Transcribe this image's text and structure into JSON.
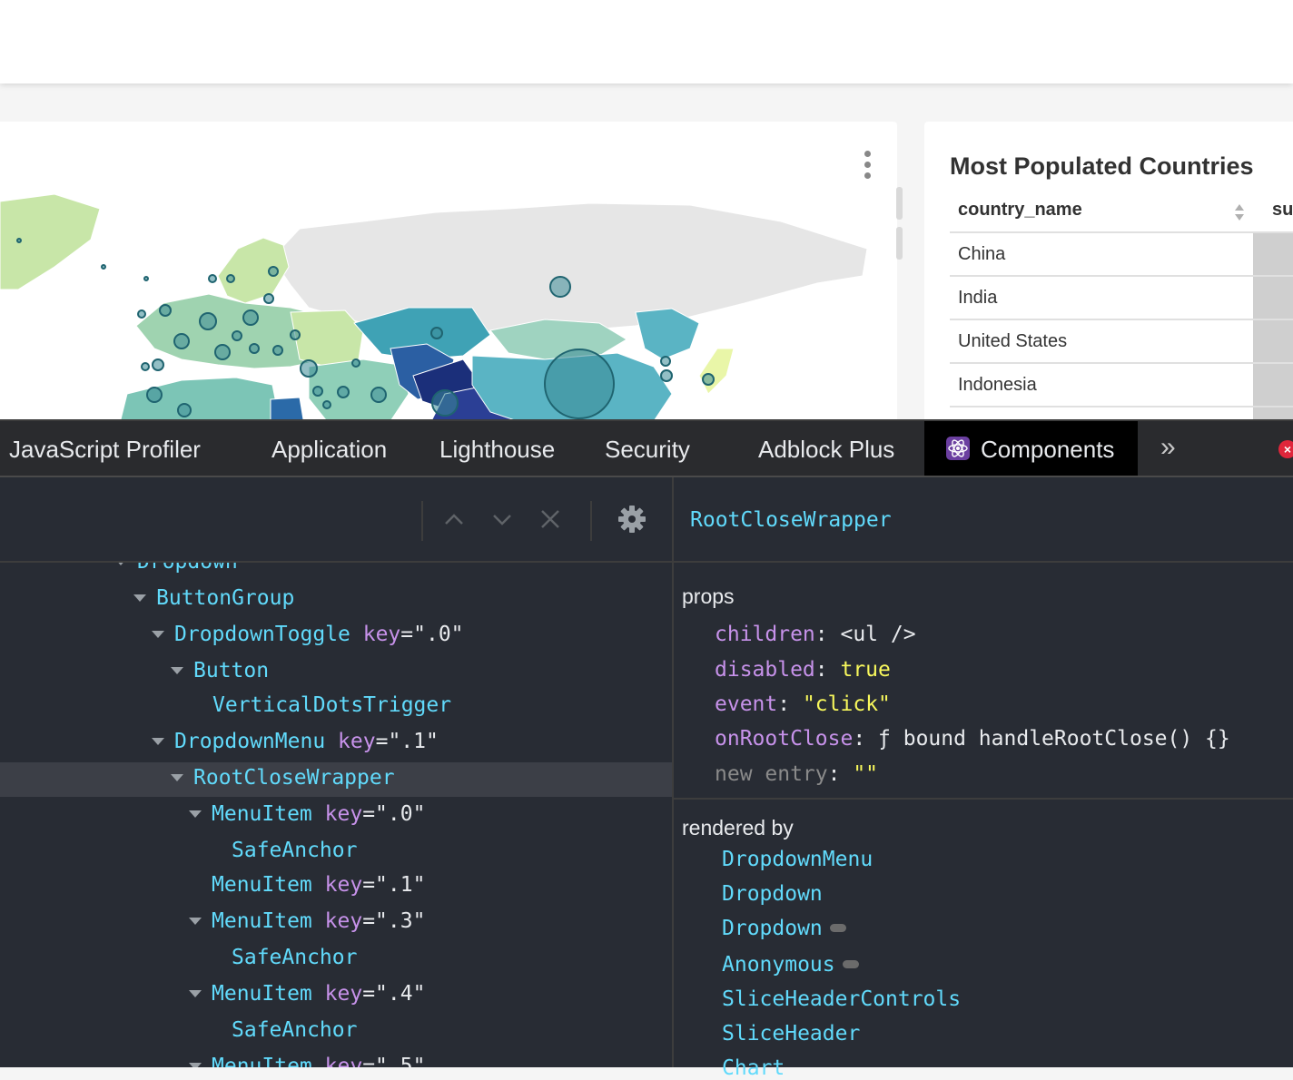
{
  "table_card": {
    "title": "Most Populated Countries",
    "columns": [
      "country_name",
      "su"
    ],
    "rows": [
      "China",
      "India",
      "United States",
      "Indonesia"
    ]
  },
  "devtools": {
    "tabs": [
      "JavaScript Profiler",
      "Application",
      "Lighthouse",
      "Security",
      "Adblock Plus",
      "Components"
    ],
    "active_tab": "Components",
    "tabs_overflow_icon": "chevron-double-right-icon",
    "toolbar_icons": [
      "chevron-up-icon",
      "chevron-down-icon",
      "close-icon",
      "gear-icon"
    ],
    "tree": [
      {
        "name": "Dropdown",
        "expanded": true
      },
      {
        "name": "ButtonGroup",
        "expanded": true
      },
      {
        "name": "DropdownToggle",
        "key_label": "key",
        "key_value": "\".0\"",
        "expanded": true
      },
      {
        "name": "Button",
        "expanded": true
      },
      {
        "name": "VerticalDotsTrigger"
      },
      {
        "name": "DropdownMenu",
        "key_label": "key",
        "key_value": "\".1\"",
        "expanded": true
      },
      {
        "name": "RootCloseWrapper",
        "expanded": true,
        "selected": true
      },
      {
        "name": "MenuItem",
        "key_label": "key",
        "key_value": "\".0\"",
        "expanded": true
      },
      {
        "name": "SafeAnchor"
      },
      {
        "name": "MenuItem",
        "key_label": "key",
        "key_value": "\".1\""
      },
      {
        "name": "MenuItem",
        "key_label": "key",
        "key_value": "\".3\"",
        "expanded": true
      },
      {
        "name": "SafeAnchor"
      },
      {
        "name": "MenuItem",
        "key_label": "key",
        "key_value": "\".4\"",
        "expanded": true
      },
      {
        "name": "SafeAnchor"
      },
      {
        "name": "MenuItem",
        "key_label": "key",
        "key_value": "\".5\"",
        "expanded": true
      }
    ],
    "selected_component": "RootCloseWrapper",
    "props_label": "props",
    "props": [
      {
        "key": "children",
        "value": "<ul />"
      },
      {
        "key": "disabled",
        "value": "true",
        "highlight": true
      },
      {
        "key": "event",
        "value": "\"click\"",
        "highlight": true
      },
      {
        "key": "onRootClose",
        "value": "ƒ bound handleRootClose() {}"
      },
      {
        "key": "new entry",
        "value": "\"\"",
        "highlight": true,
        "muted": true
      }
    ],
    "rendered_by_label": "rendered by",
    "rendered_by": [
      {
        "name": "DropdownMenu"
      },
      {
        "name": "Dropdown"
      },
      {
        "name": "Dropdown",
        "badge": true
      },
      {
        "name": "Anonymous",
        "badge": true
      },
      {
        "name": "SliceHeaderControls"
      },
      {
        "name": "SliceHeader"
      },
      {
        "name": "Chart"
      }
    ]
  }
}
